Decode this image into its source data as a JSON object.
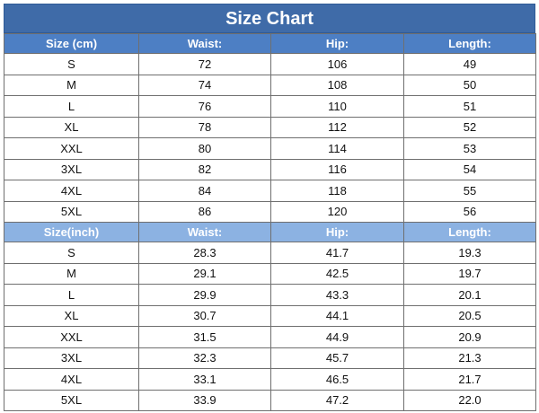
{
  "title": "Size Chart",
  "colors": {
    "title_bg": "#3f6ba8",
    "cm_header_bg": "#4d7fc4",
    "inch_header_bg": "#8cb2e2"
  },
  "cm": {
    "headers": [
      "Size (cm)",
      "Waist:",
      "Hip:",
      "Length:"
    ],
    "rows": [
      [
        "S",
        "72",
        "106",
        "49"
      ],
      [
        "M",
        "74",
        "108",
        "50"
      ],
      [
        "L",
        "76",
        "110",
        "51"
      ],
      [
        "XL",
        "78",
        "112",
        "52"
      ],
      [
        "XXL",
        "80",
        "114",
        "53"
      ],
      [
        "3XL",
        "82",
        "116",
        "54"
      ],
      [
        "4XL",
        "84",
        "118",
        "55"
      ],
      [
        "5XL",
        "86",
        "120",
        "56"
      ]
    ]
  },
  "inch": {
    "headers": [
      "Size(inch)",
      "Waist:",
      "Hip:",
      "Length:"
    ],
    "rows": [
      [
        "S",
        "28.3",
        "41.7",
        "19.3"
      ],
      [
        "M",
        "29.1",
        "42.5",
        "19.7"
      ],
      [
        "L",
        "29.9",
        "43.3",
        "20.1"
      ],
      [
        "XL",
        "30.7",
        "44.1",
        "20.5"
      ],
      [
        "XXL",
        "31.5",
        "44.9",
        "20.9"
      ],
      [
        "3XL",
        "32.3",
        "45.7",
        "21.3"
      ],
      [
        "4XL",
        "33.1",
        "46.5",
        "21.7"
      ],
      [
        "5XL",
        "33.9",
        "47.2",
        "22.0"
      ]
    ]
  }
}
